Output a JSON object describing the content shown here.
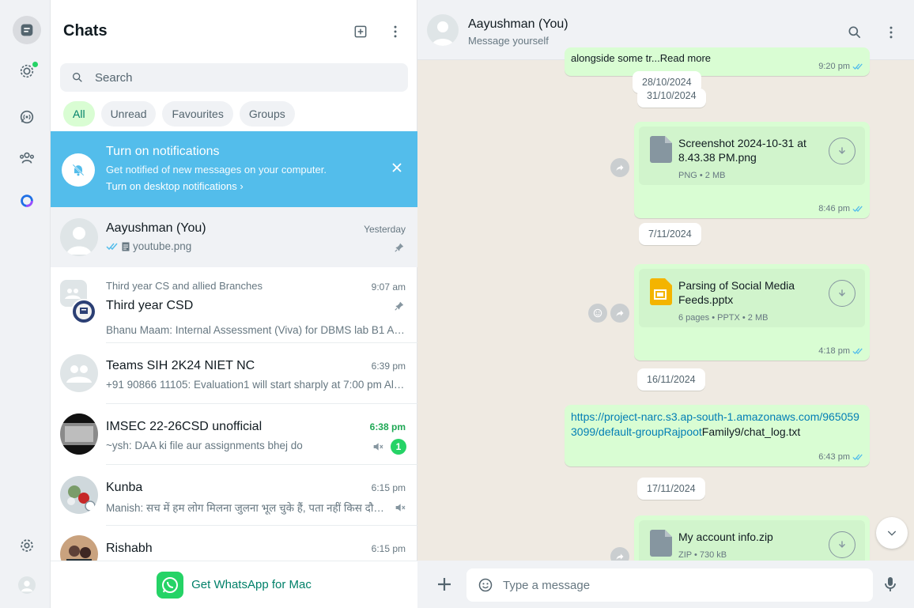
{
  "rail": {
    "icons": [
      "chats-icon",
      "status-icon",
      "channels-icon",
      "communities-icon",
      "meta-ai-icon",
      "settings-icon",
      "profile-icon"
    ]
  },
  "list": {
    "title": "Chats",
    "search_placeholder": "Search",
    "filters": [
      "All",
      "Unread",
      "Favourites",
      "Groups"
    ],
    "notification": {
      "title": "Turn on notifications",
      "subtitle": "Get notified of new messages on your computer.",
      "link": "Turn on desktop notifications ›"
    },
    "chats": [
      {
        "name": "Aayushman (You)",
        "time": "Yesterday",
        "preview": "youtube.png"
      },
      {
        "group": "Third year CS and allied Branches",
        "name": "Third year CSD",
        "time": "9:07 am",
        "preview": "Bhanu Maam: Internal Assessment (Viva) for DBMS lab B1 AND B2"
      },
      {
        "name": "Teams SIH 2K24 NIET NC",
        "time": "6:39 pm",
        "preview": "+91 90866 11105: Evaluation1 will start sharply at 7:00 pm All teams"
      },
      {
        "name": "IMSEC 22-26CSD unofficial",
        "time": "6:38 pm",
        "preview": "~ysh: DAA ki file aur assignments bhej do",
        "unread": "1"
      },
      {
        "name": "Kunba",
        "time": "6:15 pm",
        "preview": "Manish: सच में हम लोग मिलना जुलना भूल चुके हैं, पता नहीं किस दौड़ मे लगे हैं"
      },
      {
        "name": "Rishabh",
        "time": "6:15 pm",
        "preview": ""
      }
    ],
    "get_mac": "Get WhatsApp for Mac"
  },
  "conv": {
    "name": "Aayushman (You)",
    "subtitle": "Message yourself",
    "top_partial": "alongside some tr...Read more",
    "top_time": "9:20 pm",
    "dates": [
      "28/10/2024",
      "31/10/2024",
      "7/11/2024",
      "16/11/2024",
      "17/11/2024"
    ],
    "messages": [
      {
        "file": "Screenshot 2024-10-31 at 8.43.38 PM.png",
        "meta": "PNG • 2 MB",
        "time": "8:46 pm"
      },
      {
        "file": "Parsing of Social Media Feeds.pptx",
        "meta": "6 pages • PPTX • 2 MB",
        "time": "4:18 pm"
      },
      {
        "link": "https://project-narc.s3.ap-south-1.amazonaws.com/9650593099/default-groupRajpoot",
        "link_rest": "Family9/chat_log.txt",
        "time": "6:43 pm"
      },
      {
        "file": "My account info.zip",
        "meta": "ZIP • 730 kB"
      }
    ],
    "composer_placeholder": "Type a message"
  }
}
